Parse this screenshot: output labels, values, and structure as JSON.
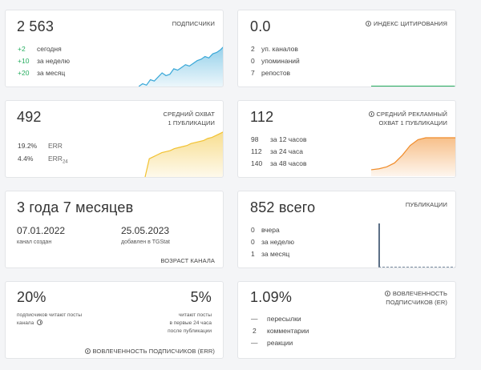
{
  "subscribers": {
    "value": "2 563",
    "label": "ПОДПИСЧИКИ",
    "rows": [
      {
        "num": "+2",
        "text": "сегодня"
      },
      {
        "num": "+10",
        "text": "за неделю"
      },
      {
        "num": "+20",
        "text": "за месяц"
      }
    ],
    "sparkline": [
      2,
      4,
      3,
      7,
      6,
      9,
      12,
      10,
      11,
      15,
      14,
      16,
      18,
      17,
      19,
      21,
      22,
      24,
      23,
      26,
      27,
      29,
      32
    ],
    "color": "#3aa8d8"
  },
  "citation": {
    "value": "0.0",
    "label": "ИНДЕКС ЦИТИРОВАНИЯ",
    "icon": "info-icon",
    "rows": [
      {
        "num": "2",
        "text": "уп. каналов"
      },
      {
        "num": "0",
        "text": "упоминаний"
      },
      {
        "num": "7",
        "text": "репостов"
      }
    ],
    "color": "#27ae60"
  },
  "reach": {
    "value": "492",
    "label_line1": "СРЕДНИЙ ОХВАТ",
    "label_line2": "1 ПУБЛИКАЦИИ",
    "rows": [
      {
        "num": "19.2%",
        "text": "ERR"
      },
      {
        "num": "4.4%",
        "text": "ERR",
        "sub": "24"
      }
    ],
    "sparkline": [
      0,
      18,
      20,
      22,
      24,
      25,
      26,
      28,
      29,
      30,
      31,
      33,
      34,
      35,
      36,
      38,
      39,
      41,
      43,
      45
    ],
    "color": "#f2c232"
  },
  "ad_reach": {
    "value": "112",
    "label_line1": "СРЕДНИЙ РЕКЛАМНЫЙ",
    "label_line2": "ОХВАТ 1 ПУБЛИКАЦИИ",
    "icon": "info-icon",
    "rows": [
      {
        "num": "98",
        "text": "за 12 часов"
      },
      {
        "num": "112",
        "text": "за 24 часа"
      },
      {
        "num": "140",
        "text": "за 48 часов"
      }
    ],
    "sparkline": [
      5,
      6,
      8,
      12,
      20,
      30,
      36,
      38,
      38,
      38,
      38,
      38
    ],
    "color": "#f08c2a"
  },
  "age": {
    "value": "3 года 7 месяцев",
    "created_date": "07.01.2022",
    "created_label": "канал создан",
    "added_date": "25.05.2023",
    "added_label": "добавлен в TGStat",
    "label": "ВОЗРАСТ КАНАЛА"
  },
  "posts": {
    "value": "852 всего",
    "label": "ПУБЛИКАЦИИ",
    "rows": [
      {
        "num": "0",
        "text": "вчера"
      },
      {
        "num": "0",
        "text": "за неделю"
      },
      {
        "num": "1",
        "text": "за месяц"
      }
    ],
    "color": "#5b6f86"
  },
  "engagement": {
    "left_value": "20%",
    "left_text_line1": "подписчиков читают посты",
    "left_text_line2": "канала",
    "right_value": "5%",
    "right_text_line1": "читают посты",
    "right_text_line2": "в первые 24 часа",
    "right_text_line3": "после публикации",
    "label": "ВОВЛЕЧЕННОСТЬ ПОДПИСЧИКОВ (ERR)",
    "icon": "info-icon"
  },
  "er": {
    "value": "1.09%",
    "label_line1": "ВОВЛЕЧЕННОСТЬ",
    "label_line2": "ПОДПИСЧИКОВ (ER)",
    "icon": "info-icon",
    "rows": [
      {
        "num": "—",
        "text": "пересылки"
      },
      {
        "num": "2",
        "text": "комментарии"
      },
      {
        "num": "—",
        "text": "реакции"
      }
    ]
  }
}
